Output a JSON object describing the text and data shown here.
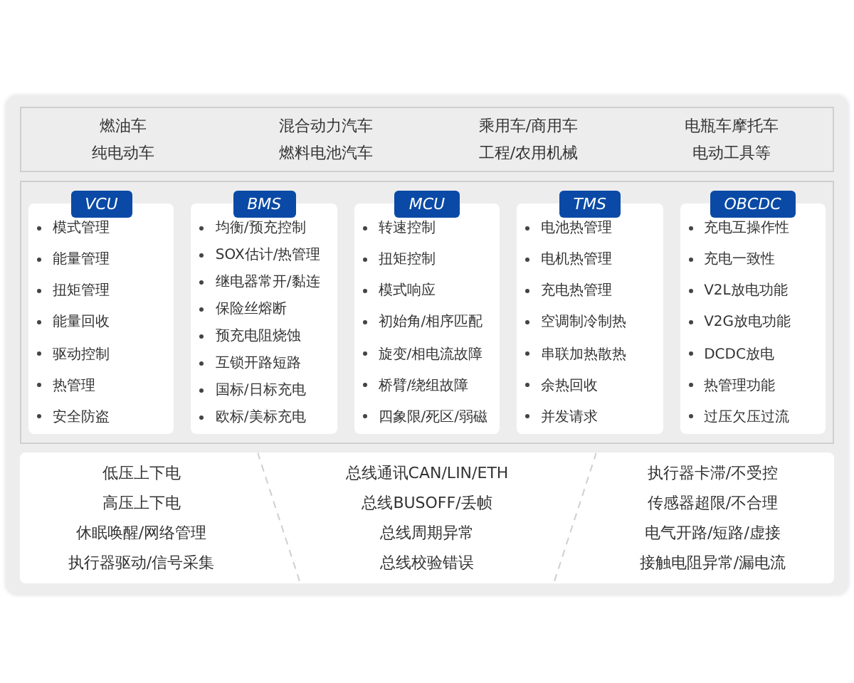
{
  "vehicle_types": [
    "燃油车",
    "混合动力汽车",
    "乘用车/商用车",
    "电瓶车摩托车",
    "纯电动车",
    "燃料电池汽车",
    "工程/农用机械",
    "电动工具等"
  ],
  "modules": [
    {
      "title": "VCU",
      "items": [
        "模式管理",
        "能量管理",
        "扭矩管理",
        "能量回收",
        "驱动控制",
        "热管理",
        "安全防盗"
      ]
    },
    {
      "title": "BMS",
      "items": [
        "均衡/预充控制",
        "SOX估计/热管理",
        "继电器常开/黏连",
        "保险丝熔断",
        "预充电阻烧蚀",
        "互锁开路短路",
        "国标/日标充电",
        "欧标/美标充电"
      ]
    },
    {
      "title": "MCU",
      "items": [
        "转速控制",
        "扭矩控制",
        "模式响应",
        "初始角/相序匹配",
        "旋变/相电流故障",
        "桥臂/绕组故障",
        "四象限/死区/弱磁"
      ]
    },
    {
      "title": "TMS",
      "items": [
        "电池热管理",
        "电机热管理",
        "充电热管理",
        "空调制冷制热",
        "串联加热散热",
        "余热回收",
        "并发请求"
      ]
    },
    {
      "title": "OBCDC",
      "items": [
        "充电互操作性",
        "充电一致性",
        "V2L放电功能",
        "V2G放电功能",
        "DCDC放电",
        "热管理功能",
        "过压欠压过流"
      ]
    }
  ],
  "common_tests": [
    [
      "低压上下电",
      "高压上下电",
      "休眠唤醒/网络管理",
      "执行器驱动/信号采集"
    ],
    [
      "总线通讯CAN/LIN/ETH",
      "总线BUSOFF/丢帧",
      "总线周期异常",
      "总线校验错误"
    ],
    [
      "执行器卡滞/不受控",
      "传感器超限/不合理",
      "电气开路/短路/虚接",
      "接触电阻异常/漏电流"
    ]
  ]
}
